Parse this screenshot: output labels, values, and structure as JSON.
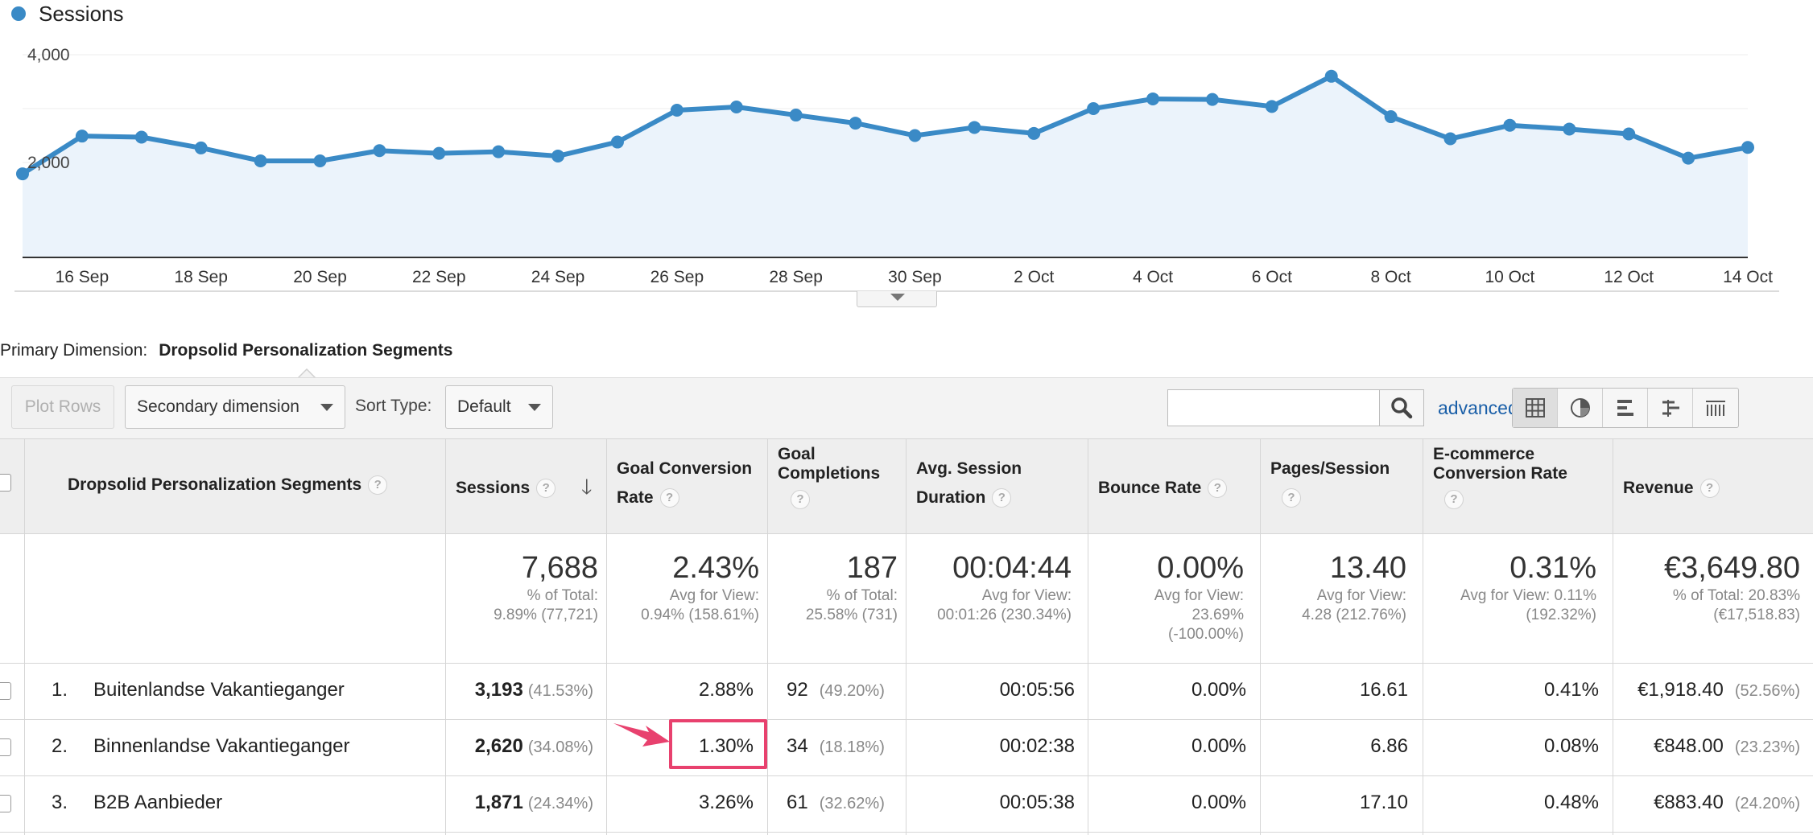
{
  "chart": {
    "legend_label": "Sessions",
    "color": "#3a8ac6",
    "fill_color": "#ebf3fb",
    "y_ticks": [
      {
        "value": 4000,
        "label": "4,000"
      },
      {
        "value": 2000,
        "label": "2,000"
      }
    ],
    "x_tick_labels": [
      "16 Sep",
      "18 Sep",
      "20 Sep",
      "22 Sep",
      "24 Sep",
      "26 Sep",
      "28 Sep",
      "30 Sep",
      "2 Oct",
      "4 Oct",
      "6 Oct",
      "8 Oct",
      "10 Oct",
      "12 Oct",
      "14 Oct"
    ]
  },
  "chart_data": {
    "type": "line",
    "title": "",
    "xlabel": "",
    "ylabel": "",
    "ylim": [
      0,
      4000
    ],
    "grid": true,
    "legend": "top-left",
    "x": [
      "15 Sep",
      "16 Sep",
      "17 Sep",
      "18 Sep",
      "19 Sep",
      "20 Sep",
      "21 Sep",
      "22 Sep",
      "23 Sep",
      "24 Sep",
      "25 Sep",
      "26 Sep",
      "27 Sep",
      "28 Sep",
      "29 Sep",
      "30 Sep",
      "1 Oct",
      "2 Oct",
      "3 Oct",
      "4 Oct",
      "5 Oct",
      "6 Oct",
      "7 Oct",
      "8 Oct",
      "9 Oct",
      "10 Oct",
      "11 Oct",
      "12 Oct",
      "13 Oct",
      "14 Oct"
    ],
    "series": [
      {
        "name": "Sessions",
        "values": [
          1790,
          2490,
          2470,
          2270,
          2030,
          2030,
          2220,
          2170,
          2200,
          2120,
          2380,
          2970,
          3030,
          2880,
          2730,
          2500,
          2650,
          2540,
          3000,
          3180,
          3170,
          3040,
          3600,
          2850,
          2440,
          2690,
          2620,
          2530,
          2080,
          2280
        ]
      }
    ]
  },
  "primary_dimension": {
    "label": "Primary Dimension:",
    "value": "Dropsolid Personalization Segments"
  },
  "toolbar": {
    "plot_rows": "Plot Rows",
    "secondary_dimension": "Secondary dimension",
    "sort_type_label": "Sort Type:",
    "sort_type_value": "Default",
    "search_value": "",
    "advanced": "advanced"
  },
  "table": {
    "headers": {
      "dimension": "Dropsolid Personalization Segments",
      "sessions": "Sessions",
      "goal_conv_1": "Goal Conversion",
      "goal_conv_2": "Rate",
      "goal_comp_1": "Goal",
      "goal_comp_2": "Completions",
      "avg_dur_1": "Avg. Session",
      "avg_dur_2": "Duration",
      "bounce": "Bounce Rate",
      "pages": "Pages/Session",
      "ecom_1": "E-commerce",
      "ecom_2": "Conversion Rate",
      "revenue": "Revenue"
    },
    "totals": {
      "sessions": {
        "value": "7,688",
        "l1": "% of Total:",
        "l2": "9.89% (77,721)"
      },
      "goal_conv": {
        "value": "2.43%",
        "l1": "Avg for View:",
        "l2": "0.94% (158.61%)"
      },
      "goal_comp": {
        "value": "187",
        "l1": "% of Total:",
        "l2": "25.58% (731)"
      },
      "avg_dur": {
        "value": "00:04:44",
        "l1": "Avg for View:",
        "l2": "00:01:26 (230.34%)"
      },
      "bounce": {
        "value": "0.00%",
        "l1": "Avg for View:",
        "l2": "23.69%",
        "l3": "(-100.00%)"
      },
      "pages": {
        "value": "13.40",
        "l1": "Avg for View:",
        "l2": "4.28 (212.76%)"
      },
      "ecom": {
        "value": "0.31%",
        "l1": "Avg for View: 0.11%",
        "l2": "(192.32%)"
      },
      "revenue": {
        "value": "€3,649.80",
        "l1": "% of Total: 20.83%",
        "l2": "(€17,518.83)"
      }
    },
    "rows": [
      {
        "idx": "1.",
        "name": "Buitenlandse Vakantieganger",
        "sessions": "3,193",
        "sessions_pct": "(41.53%)",
        "goal_conv": "2.88%",
        "goal_comp": "92",
        "goal_comp_pct": "(49.20%)",
        "avg_dur": "00:05:56",
        "bounce": "0.00%",
        "pages": "16.61",
        "ecom": "0.41%",
        "revenue": "€1,918.40",
        "revenue_pct": "(52.56%)"
      },
      {
        "idx": "2.",
        "name": "Binnenlandse Vakantieganger",
        "sessions": "2,620",
        "sessions_pct": "(34.08%)",
        "goal_conv": "1.30%",
        "goal_comp": "34",
        "goal_comp_pct": "(18.18%)",
        "avg_dur": "00:02:38",
        "bounce": "0.00%",
        "pages": "6.86",
        "ecom": "0.08%",
        "revenue": "€848.00",
        "revenue_pct": "(23.23%)"
      },
      {
        "idx": "3.",
        "name": "B2B Aanbieder",
        "sessions": "1,871",
        "sessions_pct": "(24.34%)",
        "goal_conv": "3.26%",
        "goal_comp": "61",
        "goal_comp_pct": "(32.62%)",
        "avg_dur": "00:05:38",
        "bounce": "0.00%",
        "pages": "17.10",
        "ecom": "0.48%",
        "revenue": "€883.40",
        "revenue_pct": "(24.20%)"
      }
    ],
    "highlight_color": "#e8416e"
  }
}
